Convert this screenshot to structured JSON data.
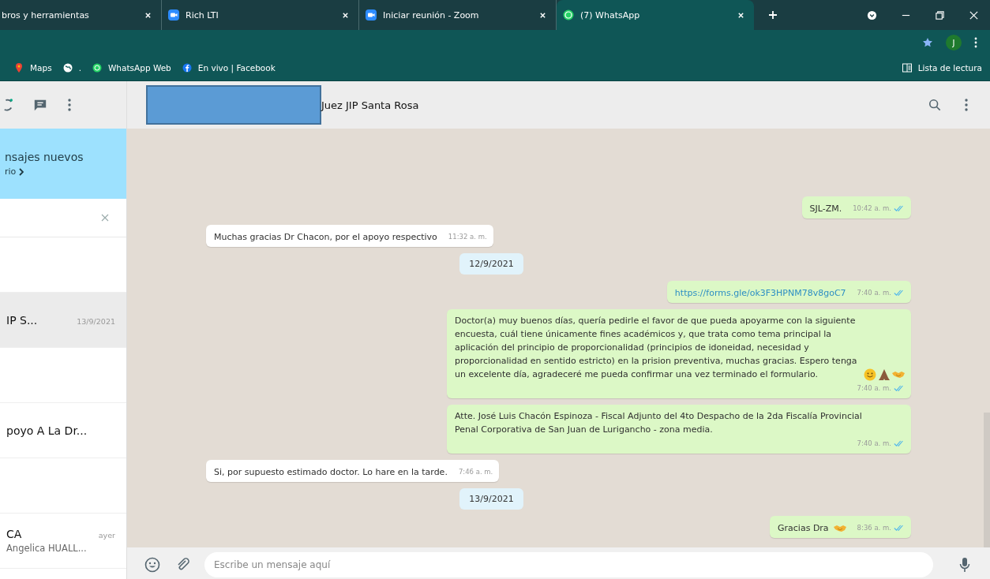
{
  "browser": {
    "tabs": [
      {
        "title": "bros y herramientas",
        "selected": false
      },
      {
        "title": "Rich LTI",
        "selected": false
      },
      {
        "title": "Iniciar reunión - Zoom",
        "selected": false
      },
      {
        "title": "(7) WhatsApp",
        "selected": true
      }
    ],
    "profile": "J",
    "bookmarks": [
      {
        "label": "Maps"
      },
      {
        "label": "."
      },
      {
        "label": "WhatsApp Web"
      },
      {
        "label": "En vivo | Facebook"
      }
    ],
    "reading_list": "Lista de lectura"
  },
  "sidebar": {
    "banner": {
      "line_1": "nsajes nuevos",
      "line_2": "rio"
    },
    "chats": [
      {
        "selected": false
      },
      {
        "name": "IP S...",
        "time": "13/9/2021",
        "selected": true
      },
      {
        "selected": false
      },
      {
        "name": "poyo A La Dr...",
        "selected": false
      },
      {
        "selected": false
      },
      {
        "name": "CA",
        "time": "ayer",
        "preview": "Angelica HUALL...",
        "selected": false
      }
    ]
  },
  "chat": {
    "name": "Juez JIP Santa Rosa",
    "messages": [
      {
        "kind": "out",
        "text": "SJL-ZM.",
        "time": "10:42 a. m.",
        "read": true
      },
      {
        "kind": "in",
        "text": "Muchas gracias Dr Chacon, por el apoyo respectivo",
        "time": "11:32 a. m."
      },
      {
        "kind": "date",
        "text": "12/9/2021"
      },
      {
        "kind": "link",
        "text": "https://forms.gle/ok3F3HPNM78v8goC7",
        "time": "7:40 a. m.",
        "read": true
      },
      {
        "kind": "out",
        "text": "Doctor(a) muy buenos días, quería pedirle el favor de que pueda apoyarme con la siguiente encuesta, cuál tiene únicamente fines académicos y, que trata como tema principal la aplicación del principio de proporcionalidad (principios de idoneidad, necesidad y proporcionalidad en sentido estricto) en la prision preventiva, muchas gracias. Espero tenga un excelente día, agradeceré me pueda confirmar una vez terminado el formulario.",
        "time": "7:40 a. m.",
        "read": true
      },
      {
        "kind": "out",
        "text": "Atte. José Luis Chacón Espinoza - Fiscal Adjunto del 4to Despacho de la 2da Fiscalía Provincial Penal Corporativa de San Juan de Lurigancho - zona media.",
        "time": "7:40 a. m.",
        "read": true
      },
      {
        "kind": "in",
        "text": "Si, por supuesto estimado doctor. Lo hare en la tarde.",
        "time": "7:46 a. m."
      },
      {
        "kind": "date",
        "text": "13/9/2021"
      },
      {
        "kind": "out",
        "text": "Gracias Dra",
        "time": "8:36 a. m.",
        "read": true
      }
    ],
    "composer": {
      "placeholder": "Escribe un mensaje aquí"
    }
  }
}
